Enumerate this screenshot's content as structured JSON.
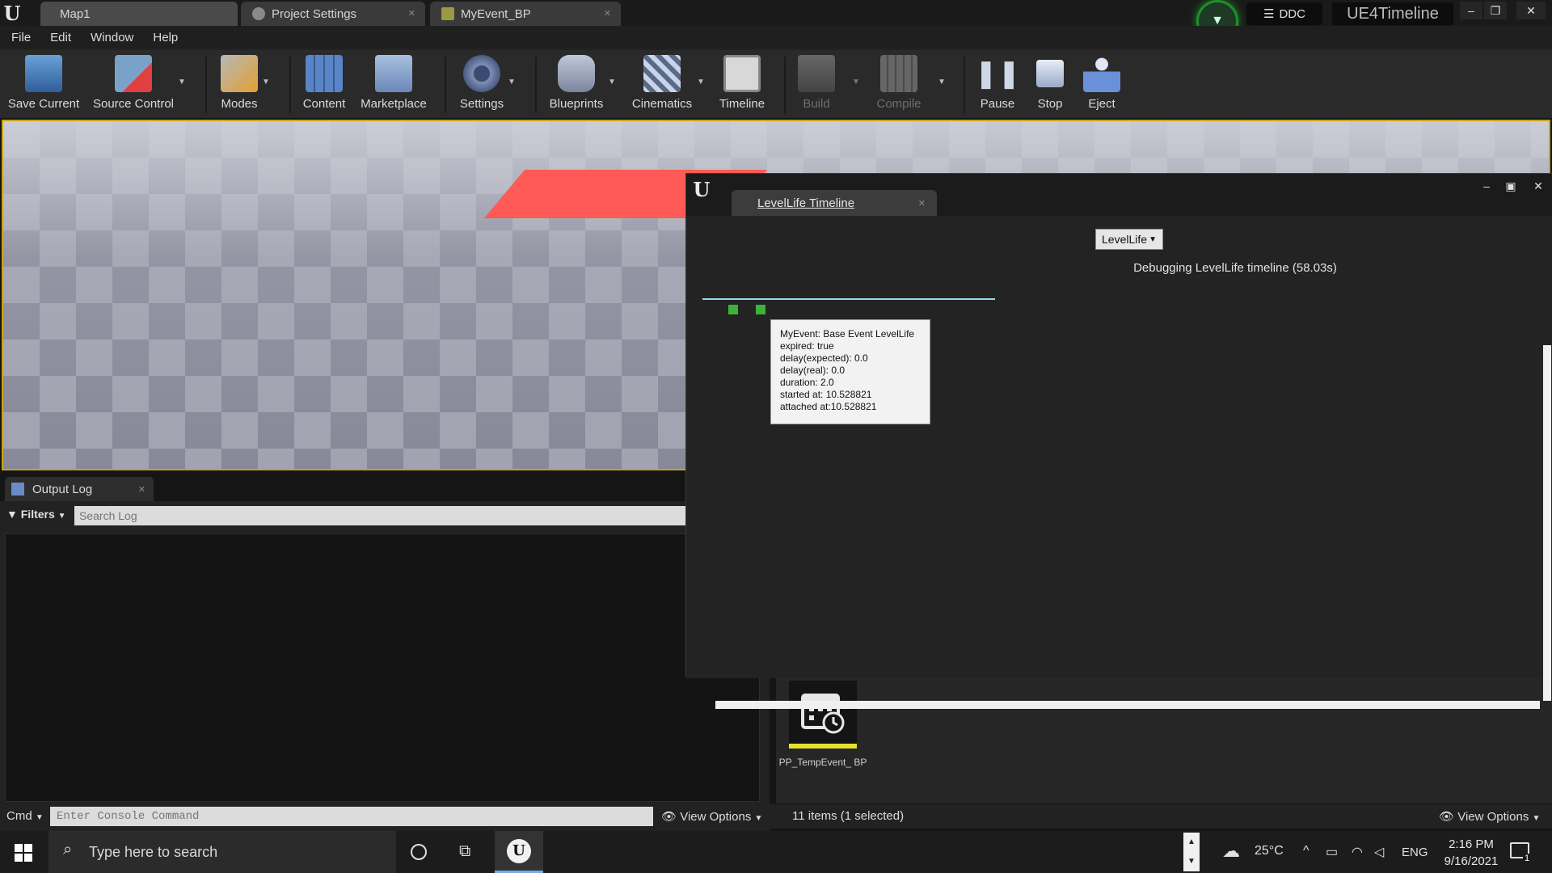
{
  "titlebar": {
    "tabs": [
      {
        "label": "Map1"
      },
      {
        "label": "Project Settings"
      },
      {
        "label": "MyEvent_BP"
      }
    ],
    "ddc_label": "DDC",
    "project_name": "UE4Timeline"
  },
  "menu": [
    "File",
    "Edit",
    "Window",
    "Help"
  ],
  "toolbar": {
    "save_current": "Save Current",
    "source_control": "Source Control",
    "modes": "Modes",
    "content": "Content",
    "marketplace": "Marketplace",
    "settings": "Settings",
    "blueprints": "Blueprints",
    "cinematics": "Cinematics",
    "timeline": "Timeline",
    "build": "Build",
    "compile": "Compile",
    "pause": "Pause",
    "stop": "Stop",
    "eject": "Eject"
  },
  "output_log": {
    "tab_label": "Output Log",
    "filters_label": "Filters",
    "search_placeholder": "Search Log"
  },
  "bottom_bar": {
    "cmd_label": "Cmd",
    "cmd_placeholder": "Enter Console Command",
    "view_options_left": "View Options",
    "items_count": "11 items (1 selected)",
    "view_options_right": "View Options"
  },
  "content_browser": {
    "asset_name": "PP_TempEvent_ BP"
  },
  "timeline_window": {
    "tab_label": "LevelLife Timeline",
    "dropdown_value": "LevelLife",
    "debug_text": "Debugging LevelLife timeline (58.03s)",
    "tooltip_lines": [
      "MyEvent: Base Event LevelLife",
      "expired: true",
      "delay(expected): 0.0",
      "delay(real): 0.0",
      "duration: 2.0",
      "started at: 10.528821",
      "attached at:10.528821"
    ]
  },
  "taskbar": {
    "search_placeholder": "Type here to search",
    "weather": "25°C",
    "language": "ENG",
    "time": "2:16 PM",
    "date": "9/16/2021",
    "notification_count": "1"
  },
  "colors": {
    "viewport_border": "#c7a41b",
    "marker_green": "#3ab33a",
    "track_cyan": "#8de0e6",
    "status_ring": "#1f8f2a"
  }
}
